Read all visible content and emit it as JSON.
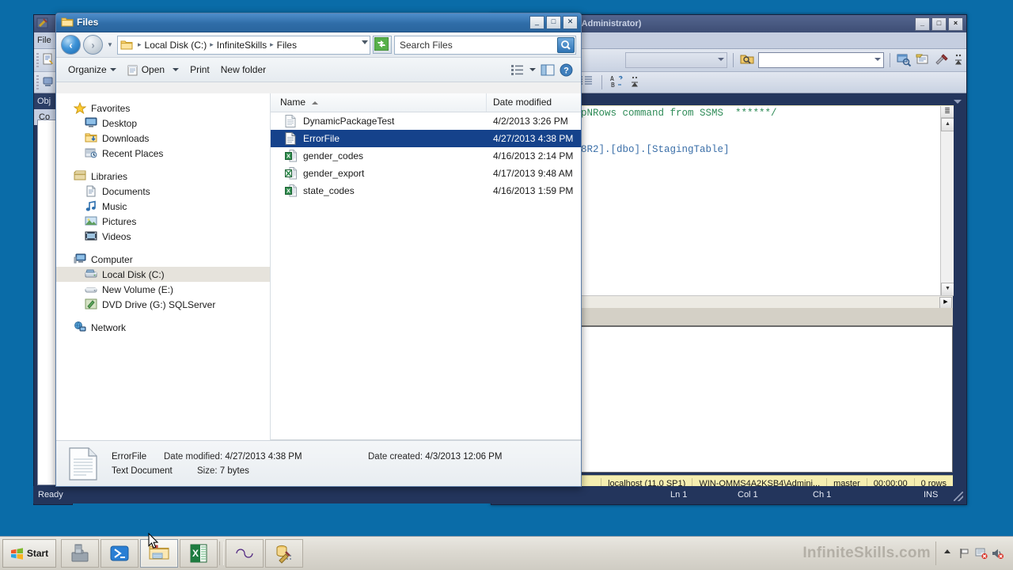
{
  "desktop": {
    "background_color": "#0a6ca8"
  },
  "ssms_window": {
    "title": "(Administrator)",
    "window_buttons": {
      "minimize": "_",
      "maximize": "□",
      "close": "×"
    },
    "tab_close_label": "✕",
    "editor_lines": [
      {
        "segments": [
          {
            "text": "pNRows command from SSMS  ******/",
            "color": "green"
          }
        ]
      },
      {
        "segments": [
          {
            "text": "",
            "color": "black"
          }
        ]
      },
      {
        "segments": [
          {
            "text": "",
            "color": "black"
          }
        ]
      },
      {
        "segments": [
          {
            "text": "8R2].[dbo].[StagingTable]",
            "color": "blue"
          }
        ]
      }
    ],
    "status_bar": {
      "server": "localhost (11.0 SP1)",
      "user": "WIN-OMMS4A2KSB4\\Admini...",
      "database": "master",
      "elapsed": "00:00:00",
      "rows": "0 rows"
    },
    "editor_status": {
      "line": "Ln 1",
      "column": "Col 1",
      "character": "Ch 1",
      "insert_mode": "INS"
    }
  },
  "left_window": {
    "menu_label": "File",
    "object_explorer_label": "Obj",
    "connect_label": "Co"
  },
  "app_status_bar": {
    "text": "Ready"
  },
  "explorer": {
    "title": "Files",
    "window_buttons": {
      "minimize": "_",
      "maximize": "□",
      "close": "✕"
    },
    "address_bar": {
      "breadcrumbs": [
        "Local Disk (C:)",
        "InfiniteSkills",
        "Files"
      ],
      "separator": "▸"
    },
    "search": {
      "placeholder": "Search Files",
      "value": ""
    },
    "toolbar": {
      "organize": "Organize",
      "open": "Open",
      "print": "Print",
      "new_folder": "New folder",
      "help": "?"
    },
    "nav_pane": {
      "groups": [
        {
          "header": {
            "label": "Favorites",
            "icon": "star-icon"
          },
          "items": [
            {
              "label": "Desktop",
              "icon": "desktop-icon"
            },
            {
              "label": "Downloads",
              "icon": "downloads-icon"
            },
            {
              "label": "Recent Places",
              "icon": "recent-places-icon"
            }
          ]
        },
        {
          "header": {
            "label": "Libraries",
            "icon": "libraries-icon"
          },
          "items": [
            {
              "label": "Documents",
              "icon": "documents-icon"
            },
            {
              "label": "Music",
              "icon": "music-icon"
            },
            {
              "label": "Pictures",
              "icon": "pictures-icon"
            },
            {
              "label": "Videos",
              "icon": "videos-icon"
            }
          ]
        },
        {
          "header": {
            "label": "Computer",
            "icon": "computer-icon"
          },
          "items": [
            {
              "label": "Local Disk (C:)",
              "icon": "hard-drive-icon",
              "selected": true
            },
            {
              "label": "New Volume (E:)",
              "icon": "drive-icon"
            },
            {
              "label": "DVD Drive (G:) SQLServer",
              "icon": "dvd-drive-icon"
            }
          ]
        },
        {
          "header": {
            "label": "Network",
            "icon": "network-icon"
          },
          "items": []
        }
      ]
    },
    "file_list": {
      "columns": [
        {
          "label": "Name",
          "sorted": "asc"
        },
        {
          "label": "Date modified"
        }
      ],
      "rows": [
        {
          "name": "DynamicPackageTest",
          "date_modified": "4/2/2013 3:26 PM",
          "icon": "text-file-icon",
          "selected": false
        },
        {
          "name": "ErrorFile",
          "date_modified": "4/27/2013 4:38 PM",
          "icon": "text-file-icon",
          "selected": true
        },
        {
          "name": "gender_codes",
          "date_modified": "4/16/2013 2:14 PM",
          "icon": "excel-file-icon",
          "selected": false
        },
        {
          "name": "gender_export",
          "date_modified": "4/17/2013 9:48 AM",
          "icon": "excel-export-icon",
          "selected": false
        },
        {
          "name": "state_codes",
          "date_modified": "4/16/2013 1:59 PM",
          "icon": "excel-file-icon",
          "selected": false
        }
      ]
    },
    "details_pane": {
      "file_name": "ErrorFile",
      "file_type": "Text Document",
      "date_modified_label": "Date modified:",
      "date_modified_value": "4/27/2013 4:38 PM",
      "date_created_label": "Date created:",
      "date_created_value": "4/3/2013 12:06 PM",
      "size_label": "Size:",
      "size_value": "7 bytes"
    }
  },
  "taskbar": {
    "start_label": "Start",
    "buttons": [
      {
        "name": "toolbox-icon"
      },
      {
        "name": "powershell-icon"
      },
      {
        "name": "file-explorer-icon",
        "active": true
      },
      {
        "name": "excel-icon"
      },
      {
        "name": "visual-studio-icon"
      },
      {
        "name": "sql-tools-icon"
      }
    ],
    "watermark": "InfiniteSkills.com",
    "tray_icons": [
      "show-hidden-icons",
      "flag-icon",
      "action-center-icon",
      "volume-muted-icon"
    ]
  }
}
